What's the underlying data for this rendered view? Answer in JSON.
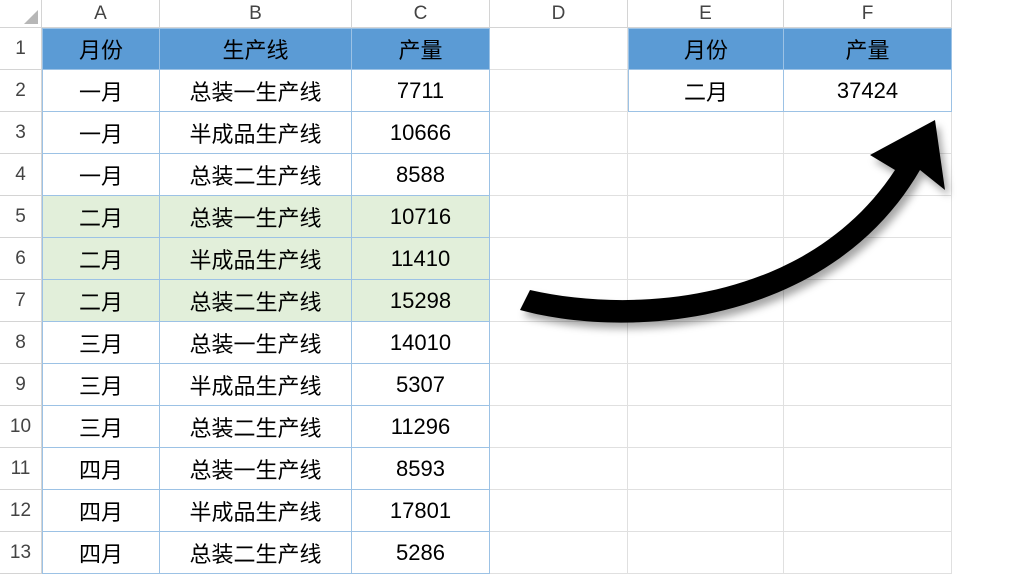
{
  "columns": [
    "A",
    "B",
    "C",
    "D",
    "E",
    "F"
  ],
  "rowNumbers": [
    "1",
    "2",
    "3",
    "4",
    "5",
    "6",
    "7",
    "8",
    "9",
    "10",
    "11",
    "12",
    "13"
  ],
  "mainHeaders": {
    "month": "月份",
    "line": "生产线",
    "output": "产量"
  },
  "sideHeaders": {
    "month": "月份",
    "output": "产量"
  },
  "mainData": [
    {
      "month": "一月",
      "line": "总装一生产线",
      "output": "7711",
      "hl": false
    },
    {
      "month": "一月",
      "line": "半成品生产线",
      "output": "10666",
      "hl": false
    },
    {
      "month": "一月",
      "line": "总装二生产线",
      "output": "8588",
      "hl": false
    },
    {
      "month": "二月",
      "line": "总装一生产线",
      "output": "10716",
      "hl": true
    },
    {
      "month": "二月",
      "line": "半成品生产线",
      "output": "11410",
      "hl": true
    },
    {
      "month": "二月",
      "line": "总装二生产线",
      "output": "15298",
      "hl": true
    },
    {
      "month": "三月",
      "line": "总装一生产线",
      "output": "14010",
      "hl": false
    },
    {
      "month": "三月",
      "line": "半成品生产线",
      "output": "5307",
      "hl": false
    },
    {
      "month": "三月",
      "line": "总装二生产线",
      "output": "11296",
      "hl": false
    },
    {
      "month": "四月",
      "line": "总装一生产线",
      "output": "8593",
      "hl": false
    },
    {
      "month": "四月",
      "line": "半成品生产线",
      "output": "17801",
      "hl": false
    },
    {
      "month": "四月",
      "line": "总装二生产线",
      "output": "5286",
      "hl": false
    }
  ],
  "sideData": {
    "month": "二月",
    "output": "37424"
  },
  "colors": {
    "headerBg": "#5b9bd5",
    "highlightBg": "#e2efda",
    "gridBorder": "#9cc2e5"
  }
}
